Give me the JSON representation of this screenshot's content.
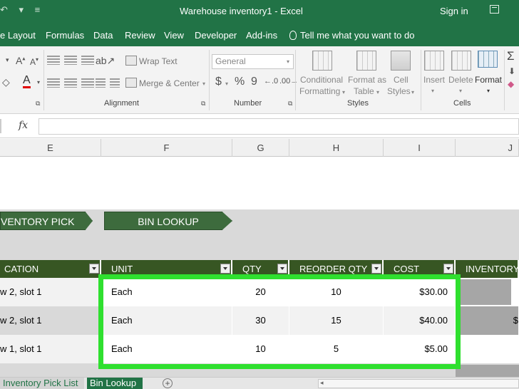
{
  "titlebar": {
    "quick_access": "↶ ▾ ≡",
    "title": "Warehouse inventory1  -  Excel",
    "signin": "Sign in"
  },
  "tabs": [
    {
      "label": "e Layout"
    },
    {
      "label": "Formulas"
    },
    {
      "label": "Data"
    },
    {
      "label": "Review"
    },
    {
      "label": "View"
    },
    {
      "label": "Developer"
    },
    {
      "label": "Add-ins"
    }
  ],
  "tell_me": "Tell me what you want to do",
  "ribbon": {
    "alignment": {
      "wrap_text": "Wrap Text",
      "merge_center": "Merge & Center",
      "label": "Alignment"
    },
    "number": {
      "format": "General",
      "dollar": "$",
      "percent": "%",
      "comma": "9",
      "label": "Number"
    },
    "styles": {
      "conditional_formatting": [
        "Conditional",
        "Formatting"
      ],
      "format_as_table": [
        "Format as",
        "Table"
      ],
      "cell_styles": [
        "Cell",
        "Styles"
      ],
      "label": "Styles"
    },
    "cells": {
      "insert": "Insert",
      "delete": "Delete",
      "format": "Format",
      "label": "Cells"
    },
    "editing": {
      "sigma": "Σ"
    }
  },
  "formula_bar": {
    "fx": "fx"
  },
  "columns": [
    "E",
    "F",
    "G",
    "H",
    "I",
    "J"
  ],
  "nav_buttons": {
    "pick_list": "VENTORY PICK LIST",
    "bin_lookup": "BIN LOOKUP"
  },
  "table": {
    "headers": [
      "CATION",
      "UNIT",
      "QTY",
      "REORDER QTY",
      "COST",
      "INVENTORY V"
    ],
    "rows": [
      {
        "location": "w 2, slot 1",
        "unit": "Each",
        "qty": "20",
        "reorder": "10",
        "cost": "$30.00",
        "inv": ""
      },
      {
        "location": "w 2, slot 1",
        "unit": "Each",
        "qty": "30",
        "reorder": "15",
        "cost": "$40.00",
        "inv": "$"
      },
      {
        "location": "w 1, slot 1",
        "unit": "Each",
        "qty": "10",
        "reorder": "5",
        "cost": "$5.00",
        "inv": ""
      }
    ]
  },
  "sheet_tabs": {
    "inventory_pick_list": "Inventory Pick List",
    "bin_lookup": "Bin Lookup",
    "add": "+"
  },
  "colors": {
    "excel_green": "#217346",
    "table_header": "#375623",
    "highlight": "#2fe02f"
  }
}
